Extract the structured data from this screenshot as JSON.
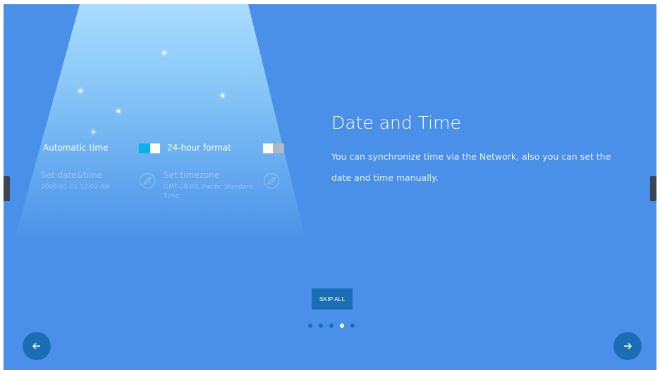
{
  "colors": {
    "background": "#4a90e8",
    "accent_dark": "#1a6fb4",
    "toggle_on": "#00b4f0",
    "toggle_off": "#b0b8c4"
  },
  "settings_preview": {
    "automatic_time": {
      "label": "Automatic time",
      "enabled": true
    },
    "hour_format": {
      "label": "24-hour format",
      "enabled": false
    },
    "set_date_time": {
      "label": "Set date&time",
      "value": "2008-01-01 12:02 AM",
      "icon": "pencil-icon"
    },
    "set_timezone": {
      "label": "Set timezone",
      "value": "GMT-08:00, Pacific Standard Time",
      "icon": "pencil-icon"
    }
  },
  "page": {
    "title": "Date and Time",
    "description": "You can synchronize time via the Network, also you can set the date and time manually."
  },
  "skip_label": "SKIP ALL",
  "pagination": {
    "total": 5,
    "current": 4
  },
  "nav": {
    "prev_icon": "arrow-left-icon",
    "next_icon": "arrow-right-icon"
  }
}
